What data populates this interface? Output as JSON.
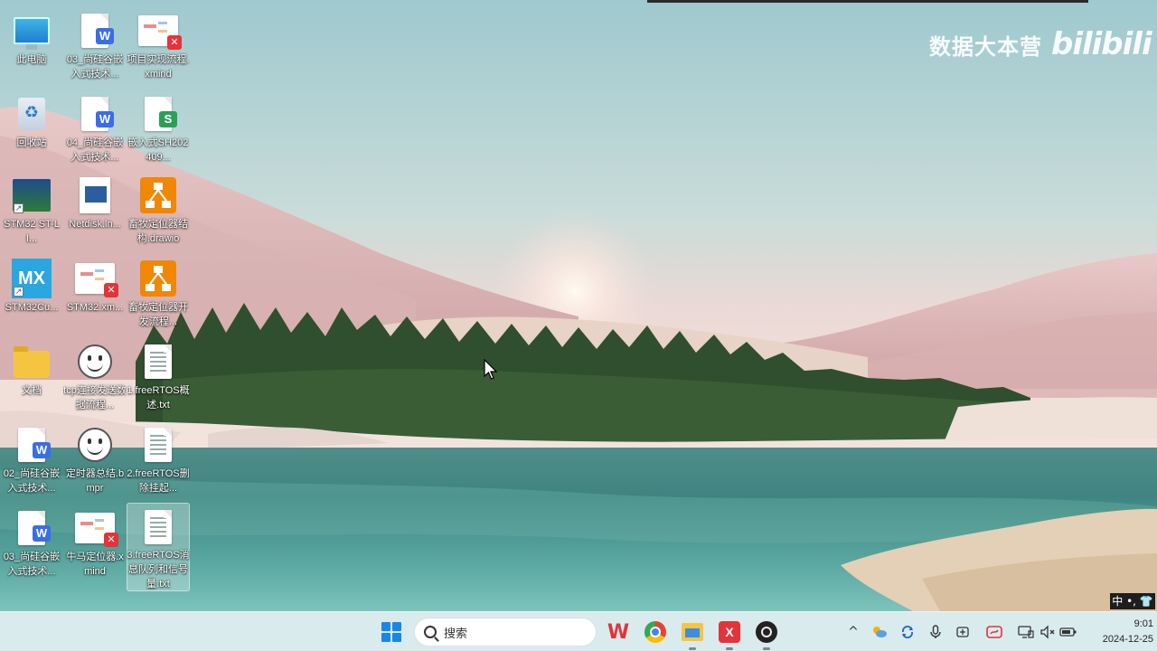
{
  "window": {
    "title": "Windows 11 桌面"
  },
  "watermark": {
    "text": "数据大本营",
    "logo": "bilibili"
  },
  "desktop": {
    "icons": [
      {
        "id": "this-pc",
        "label": "此电脑",
        "icon": "computer-icon"
      },
      {
        "id": "doc03a",
        "label": "03_尚硅谷嵌入式技术...",
        "icon": "word-doc-icon"
      },
      {
        "id": "proj-xmind",
        "label": "项目实现流程.xmind",
        "icon": "xmind-icon"
      },
      {
        "id": "recycle",
        "label": "回收站",
        "icon": "recycle-bin-icon"
      },
      {
        "id": "doc04",
        "label": "04_尚硅谷嵌入式技术...",
        "icon": "word-doc-icon"
      },
      {
        "id": "sheet",
        "label": "嵌入式SH202409...",
        "icon": "spreadsheet-icon"
      },
      {
        "id": "stm32-stlink",
        "label": "STM32 ST-LI...",
        "icon": "stlink-app-icon"
      },
      {
        "id": "netdisk",
        "label": "Netdisk.ln...",
        "icon": "netdisk-icon"
      },
      {
        "id": "drawio1",
        "label": "畜牧定位器结构.drawio",
        "icon": "drawio-icon"
      },
      {
        "id": "cubemx",
        "label": "STM32Cu...",
        "icon": "cubemx-icon"
      },
      {
        "id": "stm32-xmind",
        "label": "STM32.xm...",
        "icon": "xmind-icon"
      },
      {
        "id": "drawio2",
        "label": "畜牧定位器开发流程...",
        "icon": "drawio-icon"
      },
      {
        "id": "docs-folder",
        "label": "文档",
        "icon": "folder-icon"
      },
      {
        "id": "tcp-bmpr",
        "label": "tcp连接发送数据流程...",
        "icon": "balsamiq-icon"
      },
      {
        "id": "rtos1",
        "label": "1.freeRTOS概述.txt",
        "icon": "text-file-icon"
      },
      {
        "id": "doc02",
        "label": "02_尚硅谷嵌入式技术...",
        "icon": "word-doc-icon"
      },
      {
        "id": "timer-bmpr",
        "label": "定时器总结.bmpr",
        "icon": "balsamiq-icon"
      },
      {
        "id": "rtos2",
        "label": "2.freeRTOS删除挂起...",
        "icon": "text-file-icon"
      },
      {
        "id": "doc03b",
        "label": "03_尚硅谷嵌入式技术...",
        "icon": "word-doc-icon"
      },
      {
        "id": "cattle-xmind",
        "label": "牛马定位器.xmind",
        "icon": "xmind-icon"
      },
      {
        "id": "rtos3",
        "label": "3.freeRTOS消息队列和信号量.txt",
        "icon": "text-file-icon",
        "selected": true
      }
    ]
  },
  "ime": {
    "text": "中 •, 👕"
  },
  "taskbar": {
    "search_placeholder": "搜索",
    "apps": [
      {
        "name": "wps-app",
        "label": "W"
      },
      {
        "name": "chrome-app",
        "label": ""
      },
      {
        "name": "file-explorer-app",
        "label": ""
      },
      {
        "name": "xmind-app",
        "label": "X"
      },
      {
        "name": "obs-app",
        "label": ""
      }
    ],
    "tray": {
      "chevron": "^",
      "items": [
        "cloud-weather-icon",
        "sync-icon",
        "microphone-icon",
        "ime-icon",
        "wps-cloud-icon",
        "display-icon",
        "volume-muted-icon",
        "battery-icon"
      ]
    },
    "clock": {
      "time": "9:01",
      "date": "2024-12-25"
    }
  },
  "colors": {
    "taskbar_bg": "#ddeef0",
    "start_blue": "#1a86e8",
    "wps_red": "#e3343a",
    "word_blue": "#3a6ee8",
    "sheet_green": "#2aa055",
    "drawio_orange": "#f08705"
  }
}
